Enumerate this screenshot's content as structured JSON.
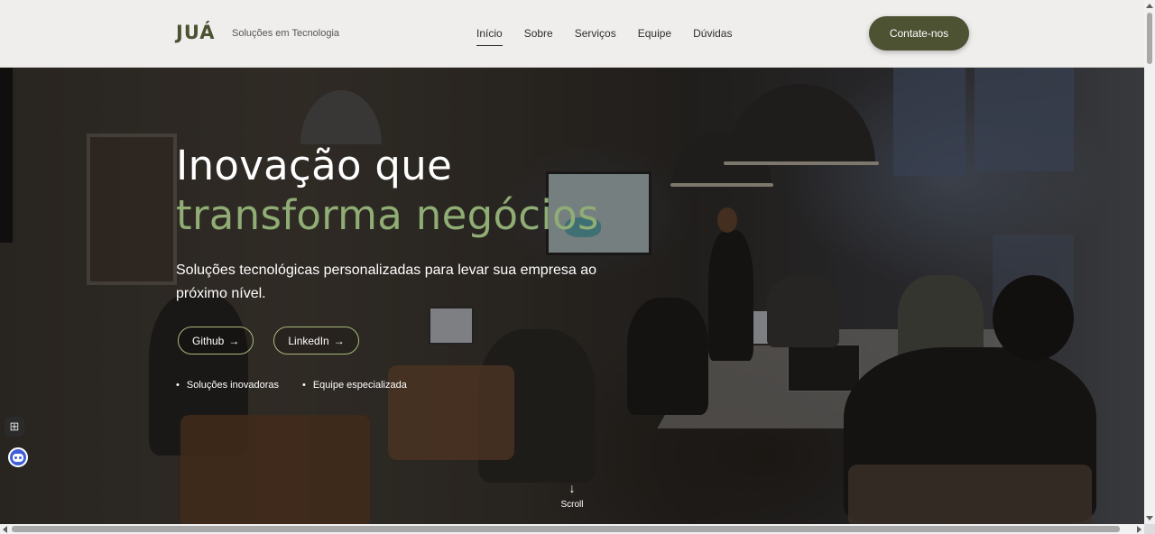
{
  "header": {
    "logo": "JUÁ",
    "tagline": "Soluções em Tecnologia",
    "nav": [
      "Início",
      "Sobre",
      "Serviços",
      "Equipe",
      "Dúvidas"
    ],
    "active_nav": "Início",
    "cta": "Contate-nos"
  },
  "hero": {
    "title_line1": "Inovação que",
    "title_line2": "transforma negócios",
    "subtitle": "Soluções tecnológicas personalizadas para levar sua empresa ao próximo nível.",
    "buttons": [
      {
        "label": "Github",
        "arrow": "→"
      },
      {
        "label": "LinkedIn",
        "arrow": "→"
      }
    ],
    "features": [
      "Soluções inovadoras",
      "Equipe especializada"
    ],
    "bullet": "•",
    "scroll_label": "Scroll",
    "scroll_arrow": "↓"
  },
  "widgets": {
    "apps_icon": "⊞"
  },
  "colors": {
    "brand": "#4a5232",
    "accent_green": "#8fad74",
    "cta_bg": "#4d5233",
    "header_bg": "#efeeec"
  }
}
